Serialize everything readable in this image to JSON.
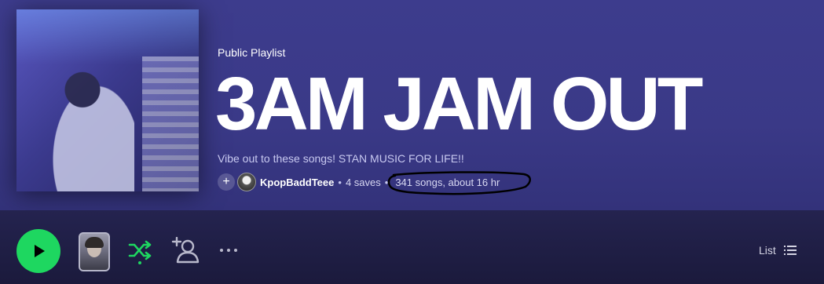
{
  "playlist": {
    "type_label": "Public Playlist",
    "title": "3AM JAM OUT",
    "description": "Vibe out to these songs! STAN MUSIC FOR LIFE!!",
    "owner": "KpopBaddTeee",
    "saves": "4 saves",
    "duration": "341 songs, about 16 hr",
    "add_symbol": "+"
  },
  "controls": {
    "view_label": "List",
    "icons": [
      "play-icon",
      "shuffle-icon",
      "add-user-icon",
      "more-icon",
      "list-icon"
    ]
  },
  "colors": {
    "accent": "#1ed760",
    "header_bg": "#3d3c8d",
    "controls_bg": "#1b1a3c"
  }
}
